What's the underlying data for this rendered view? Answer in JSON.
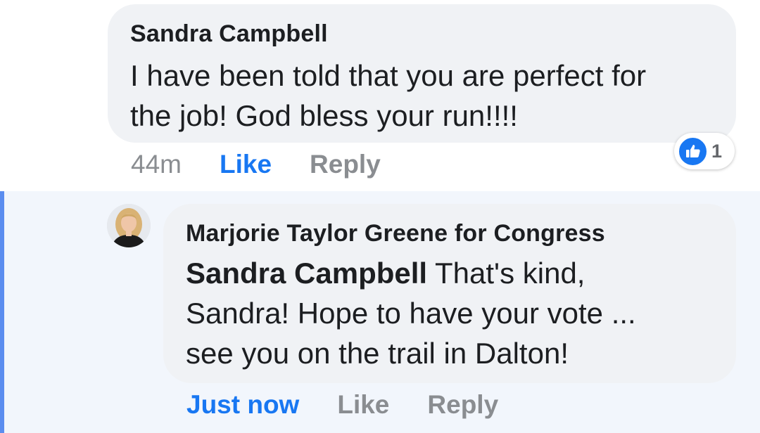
{
  "comment": {
    "author": "Sandra Campbell",
    "text_line1": "I have been told that you are perfect for",
    "text_line2": "the job! God bless your run!!!!",
    "timestamp": "44m",
    "like_label": "Like",
    "reply_label": "Reply",
    "reaction": {
      "icon": "thumbs-up-icon",
      "count": "1",
      "color": "#1877f2"
    }
  },
  "reply": {
    "author": "Marjorie Taylor Greene for Congress",
    "mention": "Sandra Campbell",
    "text_line1": " That's kind,",
    "text_line2": "Sandra! Hope to have your vote ...",
    "text_line3": "see you on the trail in Dalton!",
    "timestamp": "Just now",
    "like_label": "Like",
    "reply_label": "Reply",
    "avatar_icon": "profile-photo"
  },
  "colors": {
    "accent": "#1877f2",
    "bubble": "#f0f2f5",
    "muted": "#8a8d91",
    "highlight": "#5b8def"
  }
}
